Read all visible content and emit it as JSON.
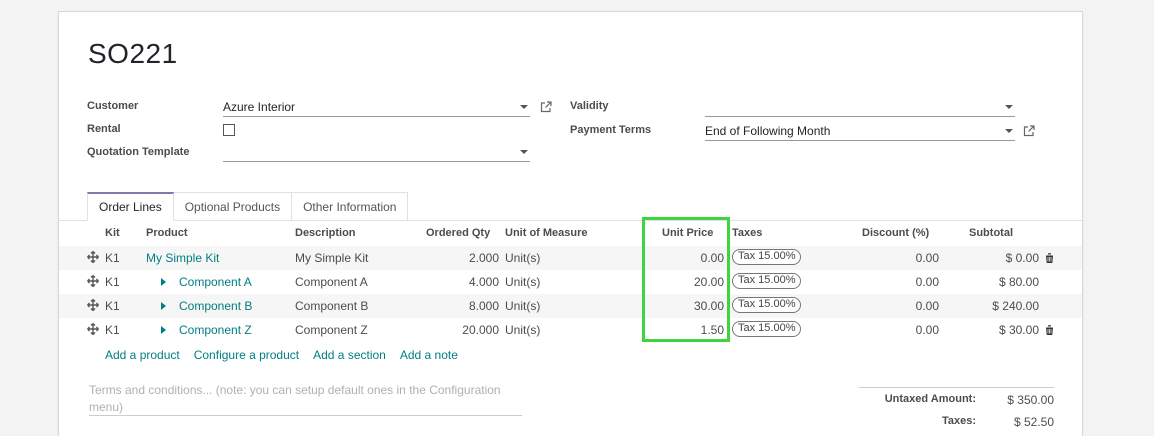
{
  "record": {
    "title": "SO221"
  },
  "form": {
    "customer_label": "Customer",
    "customer_value": "Azure Interior",
    "rental_label": "Rental",
    "quotation_template_label": "Quotation Template",
    "quotation_template_value": "",
    "validity_label": "Validity",
    "validity_value": "",
    "payment_terms_label": "Payment Terms",
    "payment_terms_value": "End of Following Month"
  },
  "tabs": [
    {
      "label": "Order Lines",
      "active": true
    },
    {
      "label": "Optional Products",
      "active": false
    },
    {
      "label": "Other Information",
      "active": false
    }
  ],
  "table": {
    "headers": {
      "kit": "Kit",
      "product": "Product",
      "description": "Description",
      "ordered_qty": "Ordered Qty",
      "uom": "Unit of Measure",
      "unit_price": "Unit Price",
      "taxes": "Taxes",
      "discount": "Discount (%)",
      "subtotal": "Subtotal"
    },
    "rows": [
      {
        "kit": "K1",
        "product": "My Simple Kit",
        "component": false,
        "description": "My Simple Kit",
        "qty": "2.000",
        "uom": "Unit(s)",
        "price": "0.00",
        "tax": "Tax 15.00%",
        "discount": "0.00",
        "subtotal": "$ 0.00",
        "deletable": true
      },
      {
        "kit": "K1",
        "product": "Component A",
        "component": true,
        "description": "Component A",
        "qty": "4.000",
        "uom": "Unit(s)",
        "price": "20.00",
        "tax": "Tax 15.00%",
        "discount": "0.00",
        "subtotal": "$ 80.00",
        "deletable": false
      },
      {
        "kit": "K1",
        "product": "Component B",
        "component": true,
        "description": "Component B",
        "qty": "8.000",
        "uom": "Unit(s)",
        "price": "30.00",
        "tax": "Tax 15.00%",
        "discount": "0.00",
        "subtotal": "$ 240.00",
        "deletable": false
      },
      {
        "kit": "K1",
        "product": "Component Z",
        "component": true,
        "description": "Component Z",
        "qty": "20.000",
        "uom": "Unit(s)",
        "price": "1.50",
        "tax": "Tax 15.00%",
        "discount": "0.00",
        "subtotal": "$ 30.00",
        "deletable": true
      }
    ]
  },
  "actions": {
    "add_product": "Add a product",
    "configure_product": "Configure a product",
    "add_section": "Add a section",
    "add_note": "Add a note"
  },
  "terms": {
    "placeholder": "Terms and conditions... (note: you can setup default ones in the Configuration menu)"
  },
  "totals": {
    "untaxed_label": "Untaxed Amount:",
    "untaxed_value": "$ 350.00",
    "taxes_label": "Taxes:",
    "taxes_value": "$ 52.50"
  },
  "colors": {
    "link": "#017e84",
    "highlight": "#3ed43e",
    "tab_active": "#7c7bad"
  }
}
